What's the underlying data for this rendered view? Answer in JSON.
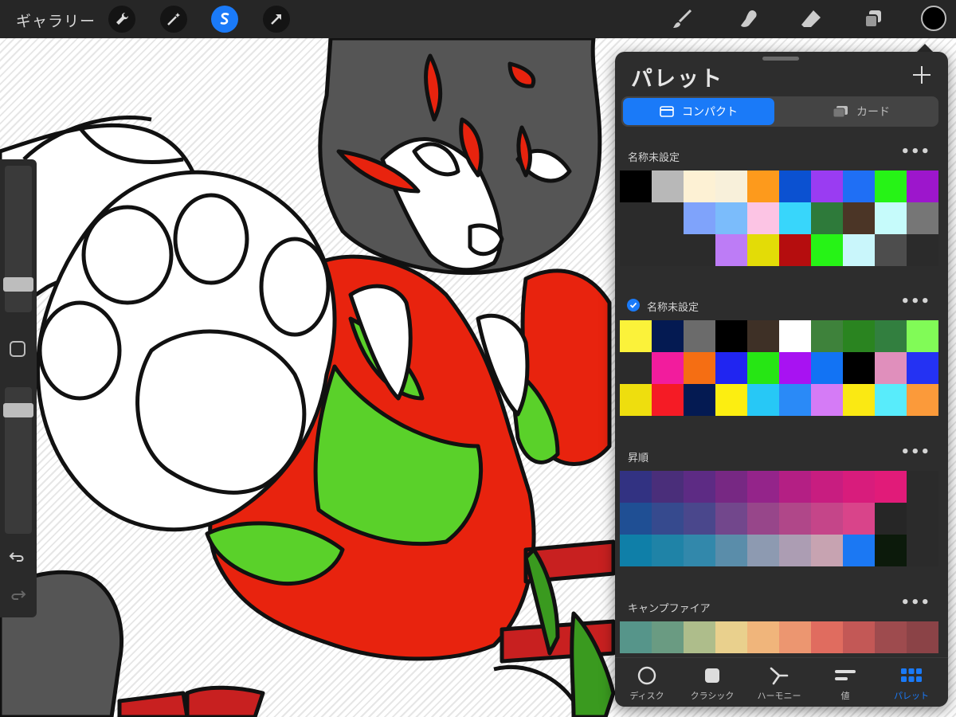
{
  "topbar": {
    "gallery_label": "ギャラリー",
    "left_tools": [
      "wrench-icon",
      "magic-wand-icon",
      "selection-icon",
      "transform-icon"
    ],
    "right_tools": [
      "brush-icon",
      "smudge-icon",
      "eraser-icon",
      "layers-icon"
    ],
    "current_color": "#000000",
    "accent": "#1a7af8"
  },
  "sidebar": {
    "brush_size_level": 0.22,
    "opacity_level": 0.85
  },
  "palette_panel": {
    "title": "パレット",
    "tabs": [
      {
        "label": "コンパクト",
        "selected": true
      },
      {
        "label": "カード",
        "selected": false
      }
    ],
    "palettes": [
      {
        "name": "名称未設定",
        "default": false,
        "colors": [
          "#000000",
          "#b8b8b8",
          "#fdf1d4",
          "#f8f0da",
          "#fd9a1c",
          "#0b51d1",
          "#9a3cf2",
          "#1f6ff5",
          "#26f316",
          "#9d16cc",
          "#2b2b2b",
          "#2b2b2b",
          "#7fa3fb",
          "#7bbcfb",
          "#fcc4e4",
          "#38d6fb",
          "#2e7a3a",
          "#4b3526",
          "#c6fbfb",
          "#767676",
          "#2b2b2b",
          "#2b2b2b",
          "#2b2b2b",
          "#bd7cf6",
          "#e3dc07",
          "#b50d0e",
          "#26f316",
          "#c9f6fb",
          "#4d4d4d",
          "#2b2b2b"
        ]
      },
      {
        "name": "名称未設定",
        "default": true,
        "colors": [
          "#fbf23a",
          "#041a52",
          "#6b6b6b",
          "#000000",
          "#3e3026",
          "#ffffff",
          "#3e823b",
          "#2a8420",
          "#327f3f",
          "#81fb57",
          "#2b2b2b",
          "#f21c9d",
          "#f56e13",
          "#2025f1",
          "#26e614",
          "#a812f2",
          "#1273f4",
          "#000000",
          "#e08fbc",
          "#2432f3",
          "#eede0e",
          "#f51b25",
          "#041a52",
          "#fcee11",
          "#27c8f6",
          "#2a8af7",
          "#d57bf6",
          "#fae913",
          "#58ecfb",
          "#fb9a3a"
        ]
      },
      {
        "name": "昇順",
        "default": false,
        "colors": [
          "#323282",
          "#4a2e7a",
          "#5d2b84",
          "#772883",
          "#94248a",
          "#b41f84",
          "#c81d80",
          "#d81c7c",
          "#e11b79",
          "#2b2b2b",
          "#1f4f94",
          "#364a8e",
          "#4a478c",
          "#72478c",
          "#97468a",
          "#b04789",
          "#c54589",
          "#d9448a",
          "#262626",
          "#2b2b2b",
          "#0f7fa8",
          "#1f83a7",
          "#3288ab",
          "#5a8daa",
          "#8d9ab1",
          "#ac9db3",
          "#c7a3b1",
          "#1b78f3",
          "#0c1a0b",
          "#2b2b2b"
        ]
      },
      {
        "name": "キャンプファイア",
        "default": false,
        "colors": [
          "#56958a",
          "#6a9b82",
          "#aebd8b",
          "#e9d08d",
          "#f0b57b",
          "#ec9670",
          "#e06c5f",
          "#c35856",
          "#9e4b4e",
          "#8b4347"
        ]
      }
    ],
    "more_label": "•••",
    "bottom_tabs": [
      {
        "label": "ディスク",
        "icon": "disc-icon",
        "selected": false
      },
      {
        "label": "クラシック",
        "icon": "classic-icon",
        "selected": false
      },
      {
        "label": "ハーモニー",
        "icon": "harmony-icon",
        "selected": false
      },
      {
        "label": "値",
        "icon": "value-icon",
        "selected": false
      },
      {
        "label": "パレット",
        "icon": "palette-grid-icon",
        "selected": true
      }
    ]
  }
}
